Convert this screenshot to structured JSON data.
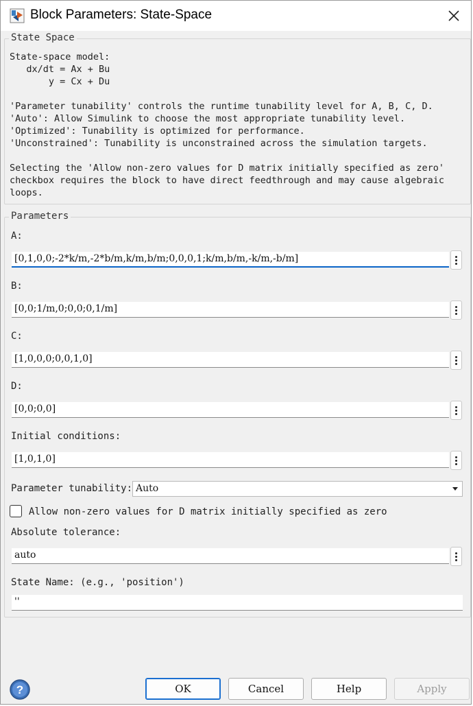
{
  "window": {
    "title": "Block Parameters: State-Space",
    "app_icon": "simulink-block-icon",
    "close_icon": "close-icon"
  },
  "description": {
    "group_title": "State Space",
    "lines": [
      "State-space model:",
      "   dx/dt = Ax + Bu",
      "       y = Cx + Du",
      "",
      "'Parameter tunability' controls the runtime tunability level for A, B, C, D.",
      "'Auto': Allow Simulink to choose the most appropriate tunability level.",
      "'Optimized': Tunability is optimized for performance.",
      "'Unconstrained': Tunability is unconstrained across the simulation targets.",
      "",
      "Selecting the 'Allow non-zero values for D matrix initially specified as zero'",
      "checkbox requires the block to have direct feedthrough and may cause algebraic",
      "loops."
    ]
  },
  "parameters": {
    "group_title": "Parameters",
    "A": {
      "label": "A:",
      "value": "[0,1,0,0;-2*k/m,-2*b/m,k/m,b/m;0,0,0,1;k/m,b/m,-k/m,-b/m]"
    },
    "B": {
      "label": "B:",
      "value": "[0,0;1/m,0;0,0;0,1/m]"
    },
    "C": {
      "label": "C:",
      "value": "[1,0,0,0;0,0,1,0]"
    },
    "D": {
      "label": "D:",
      "value": "[0,0;0,0]"
    },
    "initial_conditions": {
      "label": "Initial conditions:",
      "value": "[1,0,1,0]"
    },
    "tunability": {
      "label": "Parameter tunability:",
      "value": "Auto"
    },
    "allow_nonzero_d": {
      "label": "Allow non-zero values for D matrix initially specified as zero",
      "checked": false
    },
    "absolute_tolerance": {
      "label": "Absolute tolerance:",
      "value": "auto"
    },
    "state_name": {
      "label": "State Name: (e.g., 'position')",
      "value": "''"
    }
  },
  "buttons": {
    "help_icon": "question-mark-icon",
    "ok": "OK",
    "cancel": "Cancel",
    "help": "Help",
    "apply": "Apply"
  },
  "colors": {
    "accent": "#0a64c8",
    "dialog_bg": "#f0f0f0"
  }
}
